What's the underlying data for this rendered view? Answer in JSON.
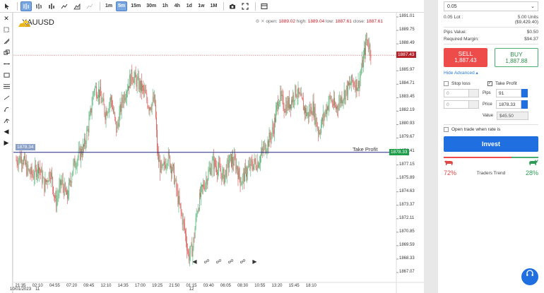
{
  "toolbar": {
    "timeframes": [
      "1m",
      "5m",
      "15m",
      "30m",
      "1h",
      "4h",
      "1d",
      "1w",
      "1M"
    ],
    "active_timeframe": "5m"
  },
  "chart": {
    "symbol": "XAUUSD",
    "ohlc": {
      "open_label": "open:",
      "open": "1889.02",
      "high_label": "high:",
      "high": "1889.04",
      "low_label": "low:",
      "low": "1887.61",
      "close_label": "close:",
      "close": "1887.61"
    },
    "current_price": "1887.43",
    "take_profit_label": "Take Profit",
    "take_profit_price": "1878.33",
    "left_marker_price": "1878.34",
    "colors": {
      "up": "#4caf6e",
      "down": "#d9534f",
      "tp_line": "#24278a",
      "current": "#c0392b",
      "tp_tag": "#1e9e4a"
    }
  },
  "chart_data": {
    "type": "candlestick",
    "y_ticks": [
      "1891.01",
      "1889.75",
      "1888.49",
      "1887.23",
      "1885.97",
      "1884.71",
      "1883.45",
      "1882.19",
      "1880.93",
      "1879.67",
      "1878.41",
      "1877.15",
      "1875.89",
      "1874.63",
      "1873.37",
      "1872.11",
      "1870.85",
      "1869.59",
      "1868.33",
      "1867.07"
    ],
    "x_ticks": [
      {
        "t": "21:35",
        "d": "10/01/2023"
      },
      {
        "t": "02:10",
        "d": "11"
      },
      {
        "t": "04:55",
        "d": ""
      },
      {
        "t": "07:20",
        "d": ""
      },
      {
        "t": "09:45",
        "d": ""
      },
      {
        "t": "12:10",
        "d": ""
      },
      {
        "t": "14:35",
        "d": ""
      },
      {
        "t": "17:00",
        "d": ""
      },
      {
        "t": "19:25",
        "d": ""
      },
      {
        "t": "21:50",
        "d": ""
      },
      {
        "t": "01:15",
        "d": "12"
      },
      {
        "t": "03:40",
        "d": ""
      },
      {
        "t": "06:05",
        "d": ""
      },
      {
        "t": "08:30",
        "d": ""
      },
      {
        "t": "10:55",
        "d": ""
      },
      {
        "t": "13:20",
        "d": ""
      },
      {
        "t": "15:45",
        "d": ""
      },
      {
        "t": "18:10",
        "d": ""
      }
    ],
    "ylim": [
      1867.07,
      1891.01
    ],
    "path": [
      [
        0,
        1877.6
      ],
      [
        8,
        1877.9
      ],
      [
        16,
        1876.6
      ],
      [
        24,
        1876.2
      ],
      [
        32,
        1877.1
      ],
      [
        40,
        1875.2
      ],
      [
        48,
        1876.6
      ],
      [
        56,
        1873.6
      ],
      [
        64,
        1875.6
      ],
      [
        72,
        1874.0
      ],
      [
        80,
        1876.9
      ],
      [
        88,
        1878.0
      ],
      [
        96,
        1878.8
      ],
      [
        104,
        1881.4
      ],
      [
        110,
        1884.4
      ],
      [
        118,
        1883.9
      ],
      [
        126,
        1882.0
      ],
      [
        134,
        1883.4
      ],
      [
        142,
        1880.4
      ],
      [
        150,
        1883.2
      ],
      [
        158,
        1884.6
      ],
      [
        164,
        1885.6
      ],
      [
        172,
        1884.8
      ],
      [
        180,
        1884.1
      ],
      [
        188,
        1882.7
      ],
      [
        196,
        1883.2
      ],
      [
        200,
        1878.0
      ],
      [
        206,
        1876.4
      ],
      [
        214,
        1878.0
      ],
      [
        222,
        1876.6
      ],
      [
        230,
        1873.6
      ],
      [
        238,
        1871.2
      ],
      [
        244,
        1868.6
      ],
      [
        250,
        1869.4
      ],
      [
        256,
        1873.0
      ],
      [
        262,
        1874.6
      ],
      [
        270,
        1876.0
      ],
      [
        278,
        1877.4
      ],
      [
        286,
        1876.8
      ],
      [
        294,
        1876.0
      ],
      [
        302,
        1877.6
      ],
      [
        310,
        1877.4
      ],
      [
        318,
        1875.6
      ],
      [
        326,
        1876.6
      ],
      [
        334,
        1877.2
      ],
      [
        342,
        1877.4
      ],
      [
        350,
        1878.6
      ],
      [
        356,
        1879.2
      ],
      [
        364,
        1880.6
      ],
      [
        372,
        1883.6
      ],
      [
        380,
        1882.6
      ],
      [
        388,
        1883.0
      ],
      [
        396,
        1884.1
      ],
      [
        404,
        1883.0
      ],
      [
        412,
        1881.8
      ],
      [
        420,
        1882.6
      ],
      [
        428,
        1880.2
      ],
      [
        436,
        1881.8
      ],
      [
        444,
        1883.4
      ],
      [
        452,
        1882.4
      ],
      [
        460,
        1883.4
      ],
      [
        468,
        1884.2
      ],
      [
        476,
        1885.0
      ],
      [
        484,
        1884.6
      ],
      [
        490,
        1886.6
      ],
      [
        496,
        1889.0
      ],
      [
        502,
        1887.8
      ]
    ]
  },
  "panel": {
    "amount": "0.05",
    "lots_label": "0.05 Lot :",
    "units": "5.00 Units",
    "units_value": "($9,429.40)",
    "pips_value_label": "Pips Value:",
    "pips_value": "$0.50",
    "required_margin_label": "Required Margin:",
    "required_margin": "$94.37",
    "sell_label": "SELL",
    "sell_price": "1,887.43",
    "buy_label": "BUY",
    "buy_price": "1,887.88",
    "hide_advanced": "Hide Advanced",
    "stop_loss": "Stop loss",
    "take_profit": "Take Profit",
    "sl_value_1": "0",
    "sl_value_2": "0",
    "pips_label": "Pips",
    "pips": "91",
    "price_label": "Price",
    "price": "1878.33",
    "value_label": "Value",
    "value": "$45.50",
    "open_when_rate": "Open trade when rate is",
    "invest": "Invest",
    "sell_trend": "72%",
    "trend_label": "Traders Trend",
    "buy_trend": "28%"
  }
}
